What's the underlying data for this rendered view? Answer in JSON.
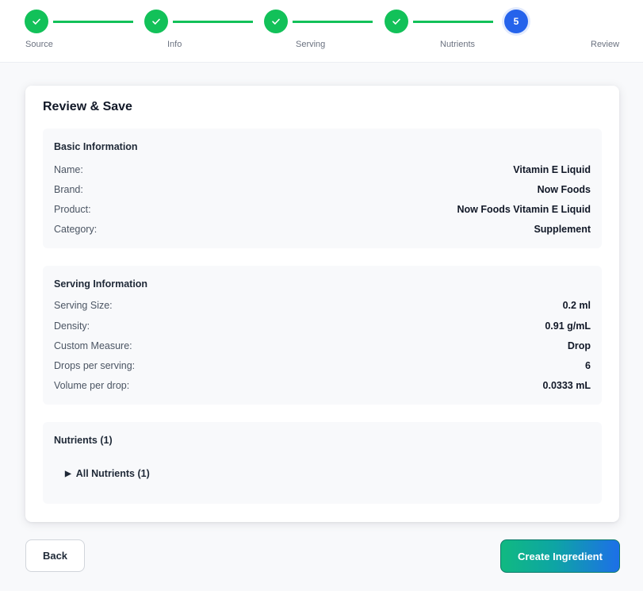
{
  "stepper": {
    "steps": [
      {
        "label": "Source",
        "state": "done"
      },
      {
        "label": "Info",
        "state": "done"
      },
      {
        "label": "Serving",
        "state": "done"
      },
      {
        "label": "Nutrients",
        "state": "done"
      },
      {
        "label": "Review",
        "state": "current",
        "number": "5"
      }
    ],
    "colors": {
      "done": "#12c159",
      "current": "#2563eb"
    }
  },
  "card": {
    "title": "Review & Save",
    "basic": {
      "title": "Basic Information",
      "rows": [
        {
          "label": "Name:",
          "value": "Vitamin E Liquid"
        },
        {
          "label": "Brand:",
          "value": "Now Foods"
        },
        {
          "label": "Product:",
          "value": "Now Foods Vitamin E Liquid"
        },
        {
          "label": "Category:",
          "value": "Supplement"
        }
      ]
    },
    "serving": {
      "title": "Serving Information",
      "rows": [
        {
          "label": "Serving Size:",
          "value": "0.2 ml"
        },
        {
          "label": "Density:",
          "value": "0.91 g/mL"
        },
        {
          "label": "Custom Measure:",
          "value": "Drop"
        },
        {
          "label": "Drops per serving:",
          "value": "6"
        },
        {
          "label": "Volume per drop:",
          "value": "0.0333 mL"
        }
      ]
    },
    "nutrients": {
      "title": "Nutrients (1)",
      "toggle_icon": "▶",
      "toggle_label": "All Nutrients (1)"
    }
  },
  "actions": {
    "back_label": "Back",
    "create_label": "Create Ingredient"
  }
}
